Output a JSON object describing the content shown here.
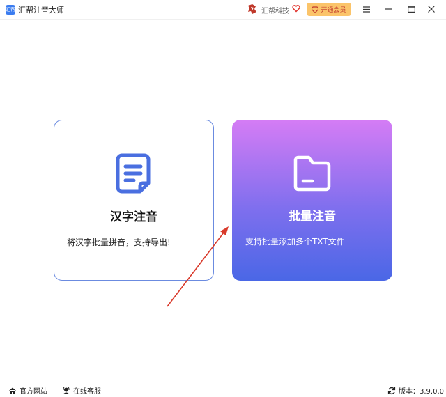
{
  "titlebar": {
    "app_logo_text": "汇帮",
    "app_title": "汇帮注音大师",
    "brand_name": "汇帮科技",
    "vip_label": "开通会员"
  },
  "cards": [
    {
      "icon": "document-icon",
      "title": "汉字注音",
      "description": "将汉字批量拼音，支持导出!"
    },
    {
      "icon": "folder-icon",
      "title": "批量注音",
      "description": "支持批量添加多个TXT文件"
    }
  ],
  "statusbar": {
    "website_label": "官方网站",
    "support_label": "在线客服",
    "version_label": "版本：3.9.0.0"
  },
  "colors": {
    "accent_blue": "#4a67e6",
    "gradient_top": "#d57cf5",
    "vip_bg": "#fbc46a",
    "arrow": "#d93a2b"
  }
}
